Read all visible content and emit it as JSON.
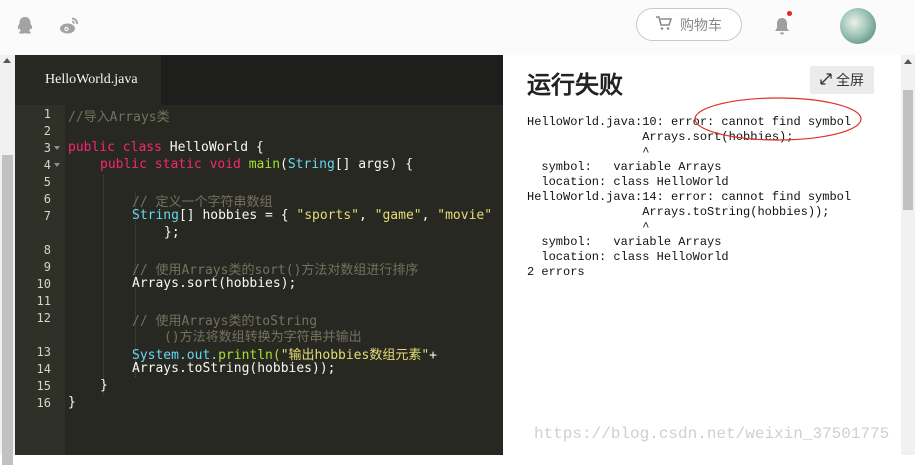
{
  "topbar": {
    "cart_label": "购物车",
    "icons": [
      "qq-icon",
      "weibo-icon",
      "cart-icon",
      "bell-icon",
      "avatar"
    ]
  },
  "editor": {
    "tab_label": "HelloWorld.java",
    "line_numbers": [
      "1",
      "2",
      "3",
      "4",
      "5",
      "6",
      "7",
      "",
      "8",
      "9",
      "10",
      "11",
      "12",
      "",
      "13",
      "14",
      "15",
      "16"
    ],
    "code": {
      "l1": "//导入Arrays类",
      "l3_kw": "public class",
      "l3_name": "HelloWorld {",
      "l4_kw": "public static void",
      "l4_fn": "main",
      "l4_type": "String",
      "l4_rest": "[] args) {",
      "l6": "// 定义一个字符串数组",
      "l7_type": "String",
      "l7_mid": "[] hobbies = { ",
      "l7_s1": "\"sports\"",
      "l7_s2": "\"game\"",
      "l7_s3": "\"movie\"",
      "l7_comma": ", ",
      "l7_end": "};",
      "l9": "// 使用Arrays类的sort()方法对数组进行排序",
      "l10": "Arrays.sort(hobbies);",
      "l12a": "// 使用Arrays类的toString",
      "l12b": "()方法将数组转换为字符串并输出",
      "l13_obj": "System.out.",
      "l13_fn": "println(",
      "l13_str": "\"输出hobbies数组元素\"",
      "l13_plus": "+",
      "l14": "Arrays.toString(hobbies));",
      "l15": "}",
      "l16": "}"
    }
  },
  "result": {
    "title": "运行失败",
    "fullscreen_label": "全屏",
    "output": "HelloWorld.java:10: error: cannot find symbol\n                Arrays.sort(hobbies);\n                ^\n  symbol:   variable Arrays\n  location: class HelloWorld\nHelloWorld.java:14: error: cannot find symbol\n                Arrays.toString(hobbies));\n                ^\n  symbol:   variable Arrays\n  location: class HelloWorld\n2 errors",
    "annotation_color": "#e0302a"
  },
  "watermark": "https://blog.csdn.net/weixin_37501775",
  "colors": {
    "editor_bg": "#272822",
    "keyword": "#f92672",
    "type": "#66d9ef",
    "string": "#e6db74",
    "comment": "#75715e",
    "function": "#a6e22e"
  }
}
